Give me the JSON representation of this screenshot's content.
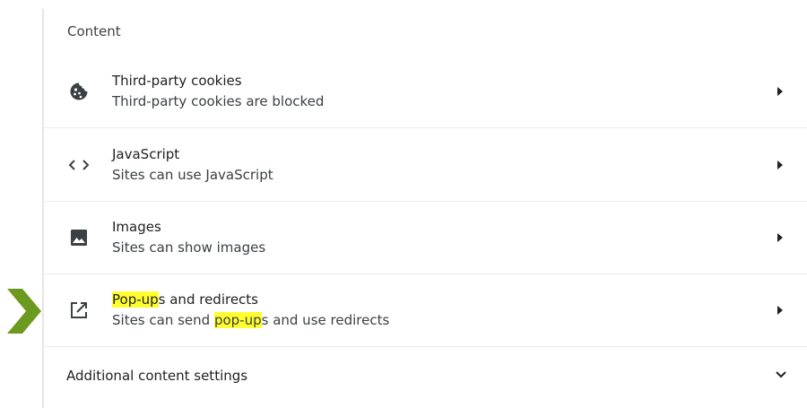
{
  "section": {
    "title": "Content"
  },
  "rows": [
    {
      "icon": "cookie-icon",
      "label": "Third-party cookies",
      "sublabel": "Third-party cookies are blocked"
    },
    {
      "icon": "code-icon",
      "label": "JavaScript",
      "sublabel": "Sites can use JavaScript"
    },
    {
      "icon": "image-icon",
      "label": "Images",
      "sublabel": "Sites can show images"
    },
    {
      "icon": "open-in-new-icon",
      "label_highlight": "Pop-up",
      "label_rest": "s and redirects",
      "sublabel_before": "Sites can send ",
      "sublabel_highlight": "pop-up",
      "sublabel_after": "s and use redirects"
    }
  ],
  "footer": {
    "label": "Additional content settings",
    "icon": "chevron-down-icon"
  },
  "colors": {
    "highlight": "#ffff30",
    "pointer": "#6b9a1f"
  }
}
